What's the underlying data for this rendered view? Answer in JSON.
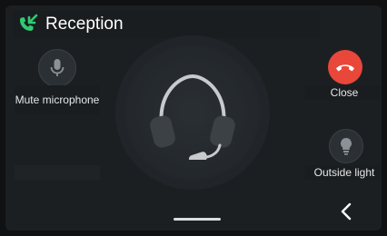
{
  "header": {
    "title": "Reception",
    "icon": "incoming-call-icon"
  },
  "left_controls": {
    "mute": {
      "label": "Mute microphone",
      "icon": "microphone-icon"
    }
  },
  "right_controls": {
    "close": {
      "label": "Close",
      "icon": "hang-up-icon",
      "color": "#e8473a"
    },
    "outside_light": {
      "label": "Outside light",
      "icon": "light-bulb-icon"
    }
  },
  "center": {
    "icon": "headset-icon"
  },
  "navigation": {
    "back_icon": "chevron-left-icon"
  },
  "colors": {
    "accent_green": "#2ecc71",
    "close_red": "#e8473a",
    "background": "#1c1f22"
  }
}
